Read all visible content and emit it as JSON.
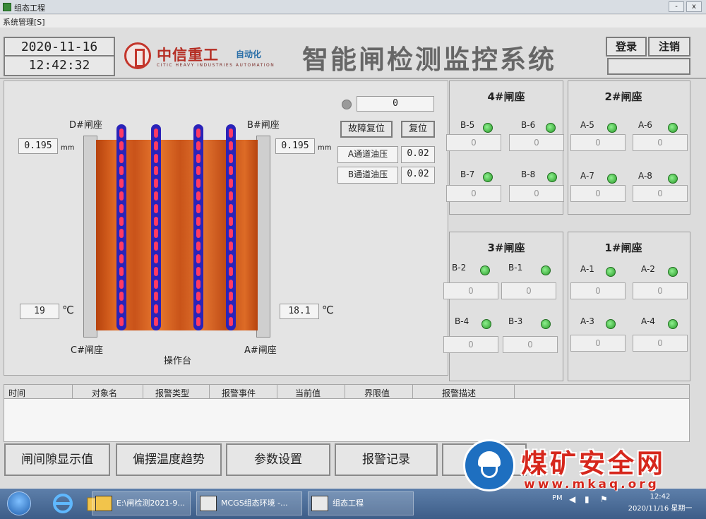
{
  "window": {
    "title": "组态工程",
    "minimize": "-",
    "close": "x"
  },
  "menu": {
    "system": "系统管理[S]"
  },
  "header": {
    "date": "2020-11-16",
    "time": "12:42:32",
    "logo_cn": "中信重工",
    "logo_auto": "自动化",
    "logo_en": "CITIC HEAVY INDUSTRIES  AUTOMATION",
    "system_title": "智能闸检测监控系统",
    "login": "登录",
    "logout": "注销"
  },
  "left": {
    "d_seat": "D#闸座",
    "b_seat": "B#闸座",
    "c_seat": "C#闸座",
    "a_seat": "A#闸座",
    "gap_left": "0.195",
    "gap_right": "0.195",
    "gap_unit": "mm",
    "temp_left": "19",
    "temp_right": "18.1",
    "temp_unit": "℃",
    "console": "操作台",
    "indicator_value": "0",
    "fault_reset": "故障复位",
    "reset": "复位",
    "a_oil_label": "A通道油压",
    "a_oil_value": "0.02",
    "b_oil_label": "B通道油压",
    "b_oil_value": "0.02"
  },
  "groups": [
    {
      "title": "4#闸座",
      "sensors": [
        {
          "name": "B-5",
          "value": "0"
        },
        {
          "name": "B-6",
          "value": "0"
        },
        {
          "name": "B-7",
          "value": "0"
        },
        {
          "name": "B-8",
          "value": "0"
        }
      ]
    },
    {
      "title": "2#闸座",
      "sensors": [
        {
          "name": "A-5",
          "value": "0"
        },
        {
          "name": "A-6",
          "value": "0"
        },
        {
          "name": "A-7",
          "value": "0"
        },
        {
          "name": "A-8",
          "value": "0"
        }
      ]
    },
    {
      "title": "3#闸座",
      "sensors": [
        {
          "name": "B-2",
          "value": "0"
        },
        {
          "name": "B-1",
          "value": "0"
        },
        {
          "name": "B-4",
          "value": "0"
        },
        {
          "name": "B-3",
          "value": "0"
        }
      ]
    },
    {
      "title": "1#闸座",
      "sensors": [
        {
          "name": "A-1",
          "value": "0"
        },
        {
          "name": "A-2",
          "value": "0"
        },
        {
          "name": "A-3",
          "value": "0"
        },
        {
          "name": "A-4",
          "value": "0"
        }
      ]
    }
  ],
  "alarm_table": {
    "columns": [
      "时间",
      "对象名",
      "报警类型",
      "报警事件",
      "当前值",
      "界限值",
      "报警描述"
    ]
  },
  "bottom_buttons": [
    "闸间隙显示值",
    "偏摆温度趋势",
    "参数设置",
    "报警记录"
  ],
  "taskbar": {
    "items": [
      "E:\\闸检测2021-9...",
      "MCGS组态环境 -...",
      "组态工程"
    ],
    "tray": {
      "lang": "PM",
      "time": "12:42",
      "date": "2020/11/16 星期一"
    }
  },
  "watermark": {
    "text": "煤矿安全网",
    "url": "www.mkaq.org"
  },
  "colors": {
    "roll": "#d65f1f",
    "bar": "#2a23b9",
    "segment": "#ff3a64",
    "indicator": "#3cc43c",
    "brand_red": "#c3352b"
  }
}
